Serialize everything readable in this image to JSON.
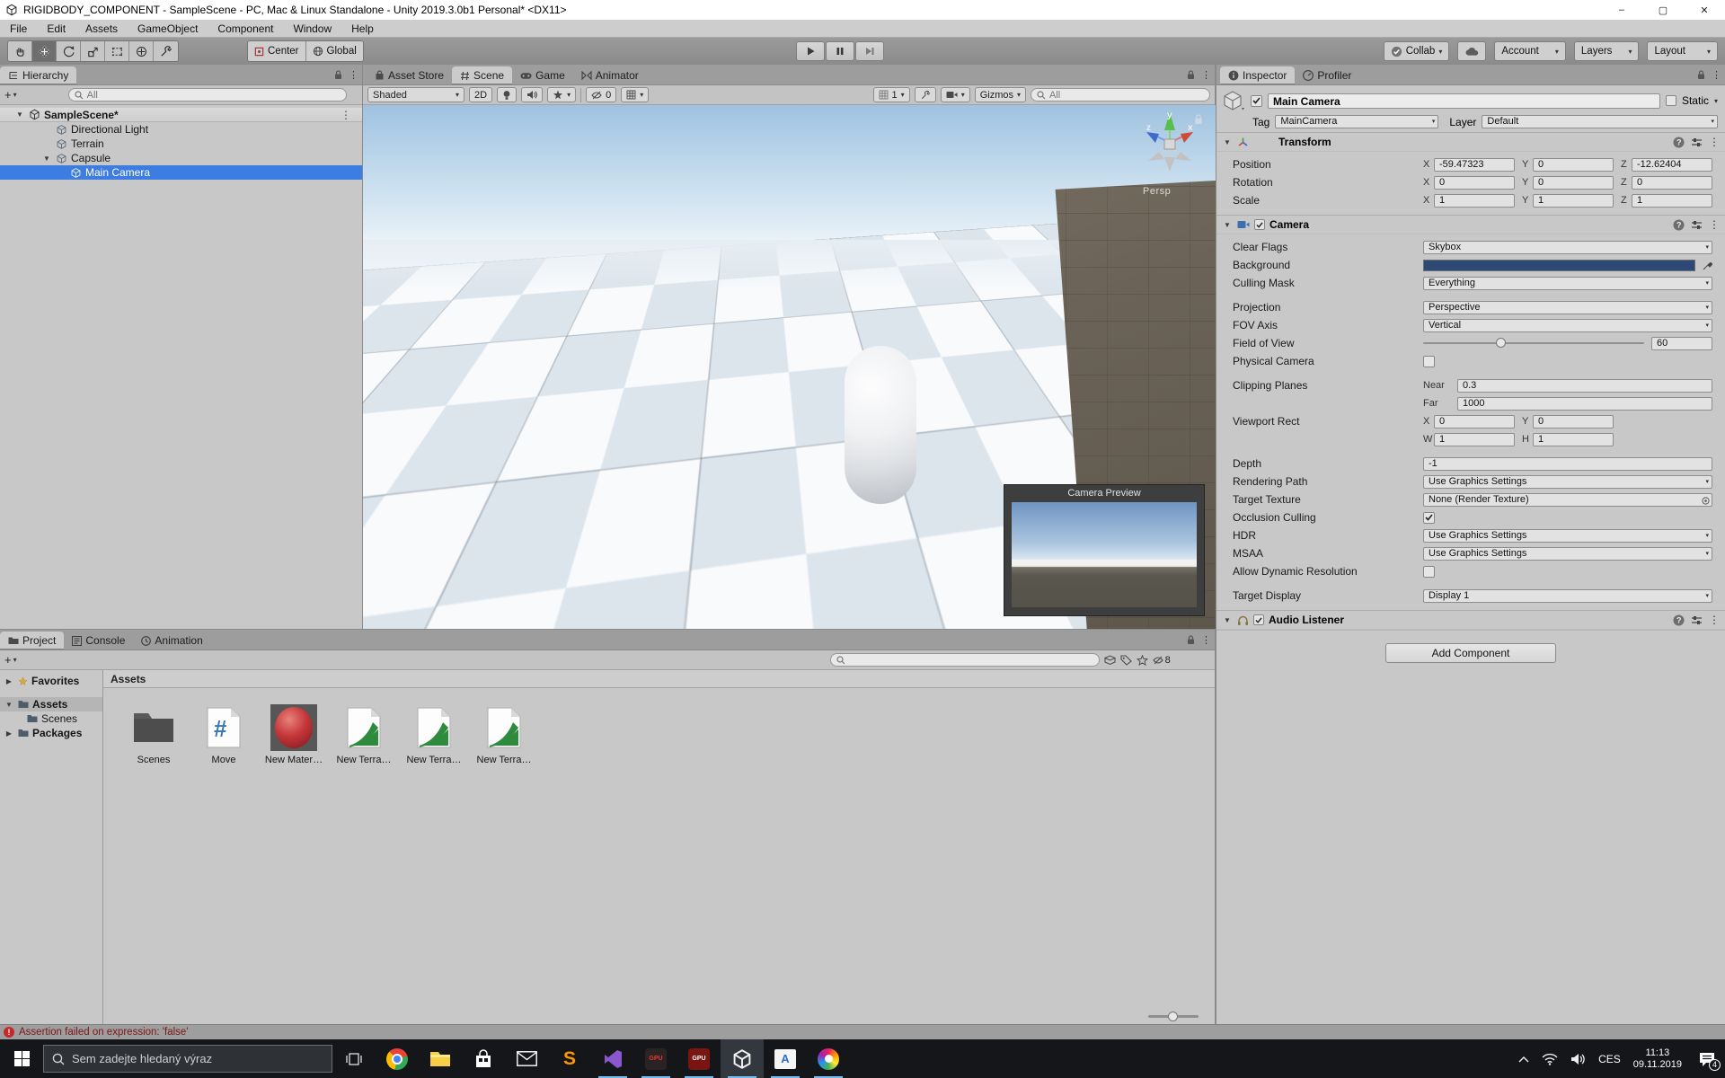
{
  "glyphs": {
    "dd": "▾",
    "menu": "⋮",
    "open": "▼",
    "closed": "▶",
    "plus": "+",
    "hash": "#",
    "min": "–",
    "max": "▢",
    "close": "✕"
  },
  "window": {
    "title": "RIGIDBODY_COMPONENT - SampleScene - PC, Mac & Linux Standalone - Unity 2019.3.0b1 Personal* <DX11>"
  },
  "menubar": {
    "items": [
      "File",
      "Edit",
      "Assets",
      "GameObject",
      "Component",
      "Window",
      "Help"
    ]
  },
  "toolbar": {
    "pivot": "Center",
    "space": "Global",
    "collab": "Collab",
    "account": "Account",
    "layers": "Layers",
    "layout": "Layout"
  },
  "hierarchy": {
    "tab": "Hierarchy",
    "search": "All",
    "scene_row": "SampleScene*",
    "items": [
      "Directional Light",
      "Terrain",
      "Capsule",
      "Main Camera"
    ]
  },
  "scene": {
    "tabs": [
      "Asset Store",
      "Scene",
      "Game",
      "Animator"
    ],
    "shaded": "Shaded",
    "d2": "2D",
    "hidden": "0",
    "grid": "1",
    "gizmos": "Gizmos",
    "search": "All",
    "persp": "Persp",
    "ax": {
      "x": "x",
      "y": "y",
      "z": "z"
    },
    "preview_title": "Camera Preview"
  },
  "inspector": {
    "tabs": [
      "Inspector",
      "Profiler"
    ],
    "name": "Main Camera",
    "static": "Static",
    "tag_label": "Tag",
    "tag": "MainCamera",
    "layer_label": "Layer",
    "layer": "Default",
    "transform": {
      "title": "Transform",
      "ax": [
        "X",
        "Y",
        "Z"
      ],
      "rows": [
        {
          "label": "Position",
          "v": [
            "-59.47323",
            "0",
            "-12.62404"
          ]
        },
        {
          "label": "Rotation",
          "v": [
            "0",
            "0",
            "0"
          ]
        },
        {
          "label": "Scale",
          "v": [
            "1",
            "1",
            "1"
          ]
        }
      ]
    },
    "camera": {
      "title": "Camera",
      "clear_flags": {
        "label": "Clear Flags",
        "value": "Skybox"
      },
      "background": {
        "label": "Background",
        "color": "#2d4a77"
      },
      "culling_mask": {
        "label": "Culling Mask",
        "value": "Everything"
      },
      "projection": {
        "label": "Projection",
        "value": "Perspective"
      },
      "fov_axis": {
        "label": "FOV Axis",
        "value": "Vertical"
      },
      "field_of_view": {
        "label": "Field of View",
        "value": "60"
      },
      "physical": {
        "label": "Physical Camera"
      },
      "clipping": {
        "label": "Clipping Planes",
        "near_label": "Near",
        "near": "0.3",
        "far_label": "Far",
        "far": "1000"
      },
      "viewport": {
        "label": "Viewport Rect",
        "xl": "X",
        "x": "0",
        "yl": "Y",
        "y": "0",
        "wl": "W",
        "w": "1",
        "hl": "H",
        "h": "1"
      },
      "depth": {
        "label": "Depth",
        "value": "-1"
      },
      "rendering_path": {
        "label": "Rendering Path",
        "value": "Use Graphics Settings"
      },
      "target_texture": {
        "label": "Target Texture",
        "value": "None (Render Texture)"
      },
      "occlusion": {
        "label": "Occlusion Culling"
      },
      "hdr": {
        "label": "HDR",
        "value": "Use Graphics Settings"
      },
      "msaa": {
        "label": "MSAA",
        "value": "Use Graphics Settings"
      },
      "dynres": {
        "label": "Allow Dynamic Resolution"
      },
      "target_display": {
        "label": "Target Display",
        "value": "Display 1"
      }
    },
    "audio": {
      "title": "Audio Listener"
    },
    "add_component": "Add Component"
  },
  "project": {
    "tabs": [
      "Project",
      "Console",
      "Animation"
    ],
    "hidden": "8",
    "tree": {
      "favorites": "Favorites",
      "assets": "Assets",
      "scenes": "Scenes",
      "packages": "Packages"
    },
    "path": "Assets",
    "assets": [
      {
        "label": "Scenes"
      },
      {
        "label": "Move"
      },
      {
        "label": "New Mater…"
      },
      {
        "label": "New Terra…"
      },
      {
        "label": "New Terra…"
      },
      {
        "label": "New Terra…"
      }
    ]
  },
  "status": {
    "message": "Assertion failed on expression: 'false'"
  },
  "taskbar": {
    "search": "Sem zadejte hledaný výraz",
    "icons": [
      "task-view",
      "chrome",
      "file-explorer",
      "store",
      "mail",
      "sublime-text",
      "visual-studio",
      "gpu-tweak",
      "gpu-tweak-2",
      "unity",
      "console-window",
      "paint-3d"
    ],
    "tray": {
      "lang": "CES",
      "time": "11:13",
      "date": "09.11.2019",
      "badge": "4"
    }
  }
}
